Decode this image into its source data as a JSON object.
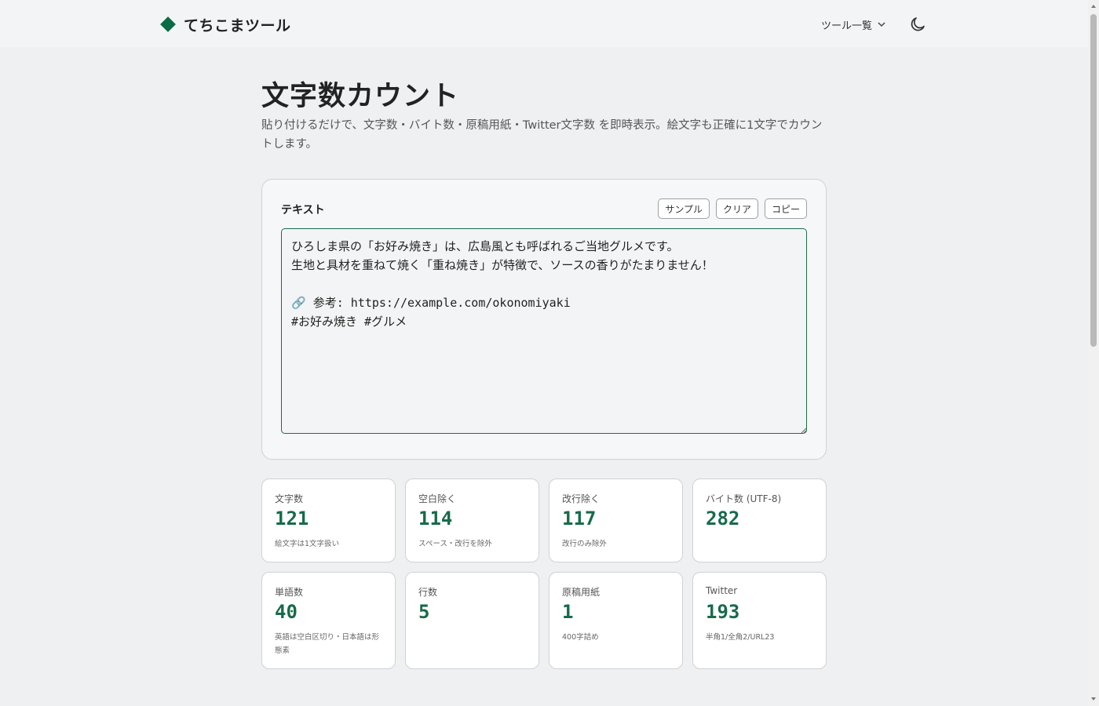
{
  "header": {
    "brand": "てちこまツール",
    "tools_menu": "ツール一覧",
    "theme_icon": "moon-icon",
    "brand_color": "#0b6b47"
  },
  "page": {
    "title": "文字数カウント",
    "description": "貼り付けるだけで、文字数・バイト数・原稿用紙・Twitter文字数 を即時表示。絵文字も正確に1文字でカウントします。"
  },
  "editor": {
    "label": "テキスト",
    "buttons": {
      "sample": "サンプル",
      "clear": "クリア",
      "copy": "コピー"
    },
    "value": "ひろしま県の「お好み焼き」は、広島風とも呼ばれるご当地グルメです。\n生地と具材を重ねて焼く「重ね焼き」が特徴で、ソースの香りがたまりません！\n\n🔗 参考: https://example.com/okonomiyaki\n#お好み焼き #グルメ"
  },
  "stats": [
    {
      "label": "文字数",
      "value": "121",
      "note": "絵文字は1文字扱い"
    },
    {
      "label": "空白除く",
      "value": "114",
      "note": "スペース・改行を除外"
    },
    {
      "label": "改行除く",
      "value": "117",
      "note": "改行のみ除外"
    },
    {
      "label": "バイト数 (UTF-8)",
      "value": "282",
      "note": ""
    },
    {
      "label": "単語数",
      "value": "40",
      "note": "英語は空白区切り・日本語は形態素"
    },
    {
      "label": "行数",
      "value": "5",
      "note": ""
    },
    {
      "label": "原稿用紙",
      "value": "1",
      "note": "400字詰め"
    },
    {
      "label": "Twitter",
      "value": "193",
      "note": "半角1/全角2/URL23"
    }
  ],
  "accent_color": "#176b4a"
}
